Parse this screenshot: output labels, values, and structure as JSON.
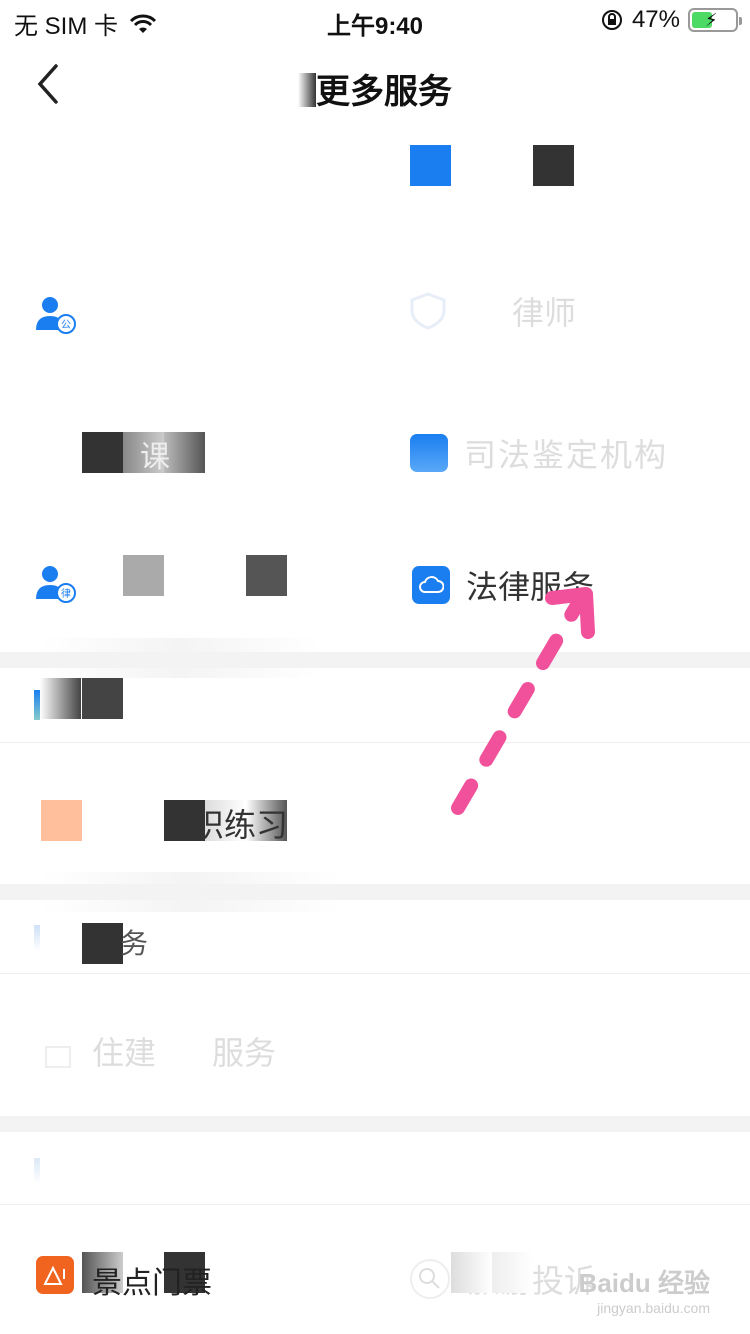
{
  "status": {
    "carrier": "无 SIM 卡",
    "time": "上午9:40",
    "battery": "47%",
    "battery_level": 0.47
  },
  "header": {
    "title": "更多服务",
    "back_icon": "chevron-left-icon"
  },
  "grid": {
    "row1_right_label": "律师",
    "row3_left_label": "课",
    "row3_right_label": "司法鉴定机构",
    "row4_right_label": "法律服务"
  },
  "sections": {
    "practice_label": "识练习",
    "section3_label": "务",
    "housing_label": "住建",
    "housing_right_label": "服务",
    "tickets_label": "景点门票",
    "travel_label": "旅游投诉"
  },
  "watermark": {
    "brand": "Baidu 经验",
    "url": "jingyan.baidu.com"
  },
  "colors": {
    "accent": "#1a7ef0",
    "dark_mask": "#333333",
    "arrow": "#f0519a",
    "orange": "#f06420"
  }
}
